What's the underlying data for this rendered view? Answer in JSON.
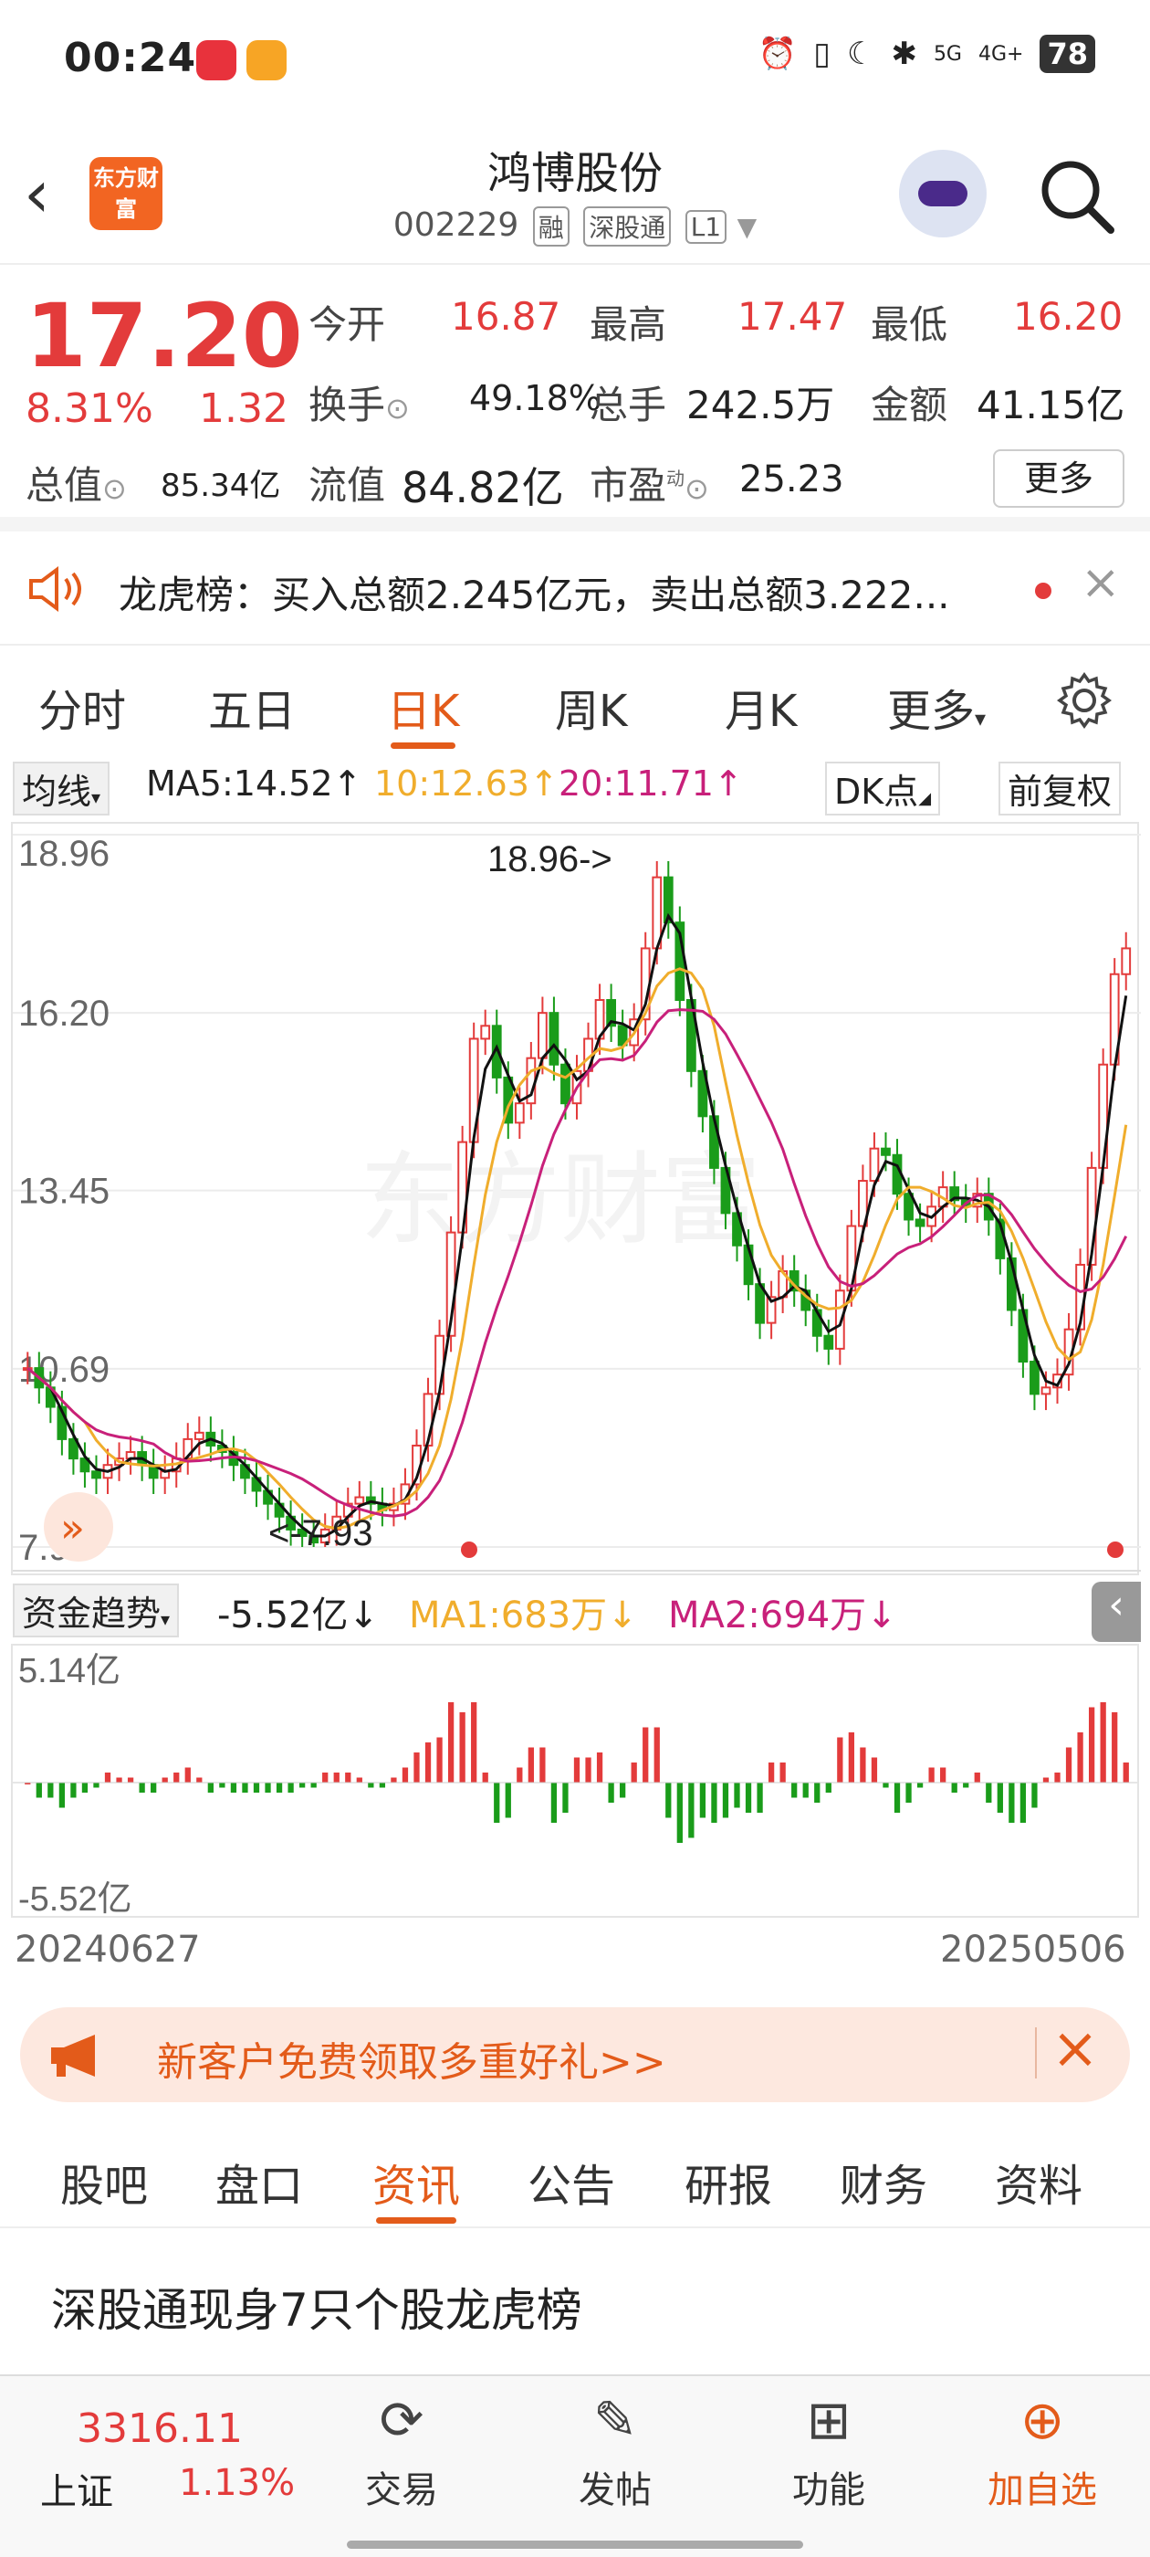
{
  "status": {
    "time": "00:24",
    "battery": "78",
    "net1": "5G",
    "net2": "4G+"
  },
  "header": {
    "title": "鸿博股份",
    "code": "002229",
    "tags": [
      "融",
      "深股通",
      "L1"
    ],
    "logo_text": "东方财富"
  },
  "quote": {
    "price": "17.20",
    "pct": "8.31%",
    "change": "1.32",
    "open_l": "今开",
    "open": "16.87",
    "high_l": "最高",
    "high": "17.47",
    "low_l": "最低",
    "low": "16.20",
    "turnover_l": "换手",
    "turnover": "49.18%",
    "vol_l": "总手",
    "vol": "242.5万",
    "amt_l": "金额",
    "amt": "41.15亿",
    "mcap_l": "总值",
    "mcap": "85.34亿",
    "float_l": "流值",
    "float": "84.82亿",
    "pe_l": "市盈",
    "pe_sup": "动",
    "pe": "25.23",
    "more": "更多"
  },
  "lhb": {
    "text": "龙虎榜：买入总额2.245亿元，卖出总额3.222..."
  },
  "tabs": [
    "分时",
    "五日",
    "日K",
    "周K",
    "月K",
    "更多"
  ],
  "ind": {
    "ma_sel": "均线",
    "ma5": "MA5:14.52",
    "ma10": "10:12.63",
    "ma20": "20:11.71",
    "dk": "DK点",
    "fq": "前复权"
  },
  "colors": {
    "up": "#e33b3b",
    "down": "#1a9c1a",
    "ma5": "#111111",
    "ma10": "#f0ad2c",
    "ma20": "#c8207a",
    "accent": "#e35b1a"
  },
  "chart_data": {
    "type": "candlestick",
    "y_ticks": [
      "18.96",
      "16.20",
      "13.45",
      "10.69",
      "7.93"
    ],
    "ylim": [
      7.93,
      18.96
    ],
    "high_label": "18.96->",
    "low_label": "<-7.93",
    "start_date": "20240627",
    "end_date": "20250506",
    "close": [
      10.7,
      10.4,
      10.1,
      9.6,
      9.3,
      9.1,
      9.0,
      9.2,
      9.3,
      9.4,
      9.2,
      9.0,
      9.1,
      9.3,
      9.6,
      9.7,
      9.5,
      9.4,
      9.2,
      9.0,
      8.8,
      8.6,
      8.4,
      8.2,
      8.1,
      8.0,
      8.2,
      8.4,
      8.6,
      8.7,
      8.6,
      8.5,
      8.6,
      8.9,
      9.5,
      10.3,
      11.2,
      12.8,
      14.2,
      15.8,
      16.0,
      15.2,
      14.5,
      14.8,
      15.5,
      16.2,
      15.4,
      14.8,
      15.3,
      15.8,
      16.4,
      16.0,
      15.7,
      16.1,
      17.2,
      18.3,
      17.6,
      16.4,
      15.3,
      14.6,
      13.8,
      13.1,
      12.6,
      12.0,
      11.4,
      11.8,
      12.2,
      11.9,
      11.6,
      11.2,
      11.0,
      11.9,
      12.9,
      13.6,
      14.1,
      14.0,
      13.4,
      13.0,
      12.9,
      13.2,
      13.5,
      13.3,
      13.2,
      13.4,
      13.0,
      12.4,
      11.6,
      10.8,
      10.3,
      10.4,
      10.6,
      11.3,
      12.3,
      13.8,
      15.4,
      16.8,
      17.2
    ]
  },
  "fund": {
    "label": "资金趋势",
    "value": "-5.52亿",
    "ma1": "MA1:683万",
    "ma2": "MA2:694万",
    "y_top": "5.14亿",
    "y_bot": "-5.52亿"
  },
  "promo": {
    "text": "新客户免费领取多重好礼>>"
  },
  "btabs": [
    "股吧",
    "盘口",
    "资讯",
    "公告",
    "研报",
    "财务",
    "资料"
  ],
  "news": {
    "title": "深股通现身7只个股龙虎榜"
  },
  "bottom": {
    "index_val": "3316.11",
    "index_name": "上证",
    "index_pct": "1.13%",
    "nav": [
      "交易",
      "发帖",
      "功能",
      "加自选"
    ]
  }
}
